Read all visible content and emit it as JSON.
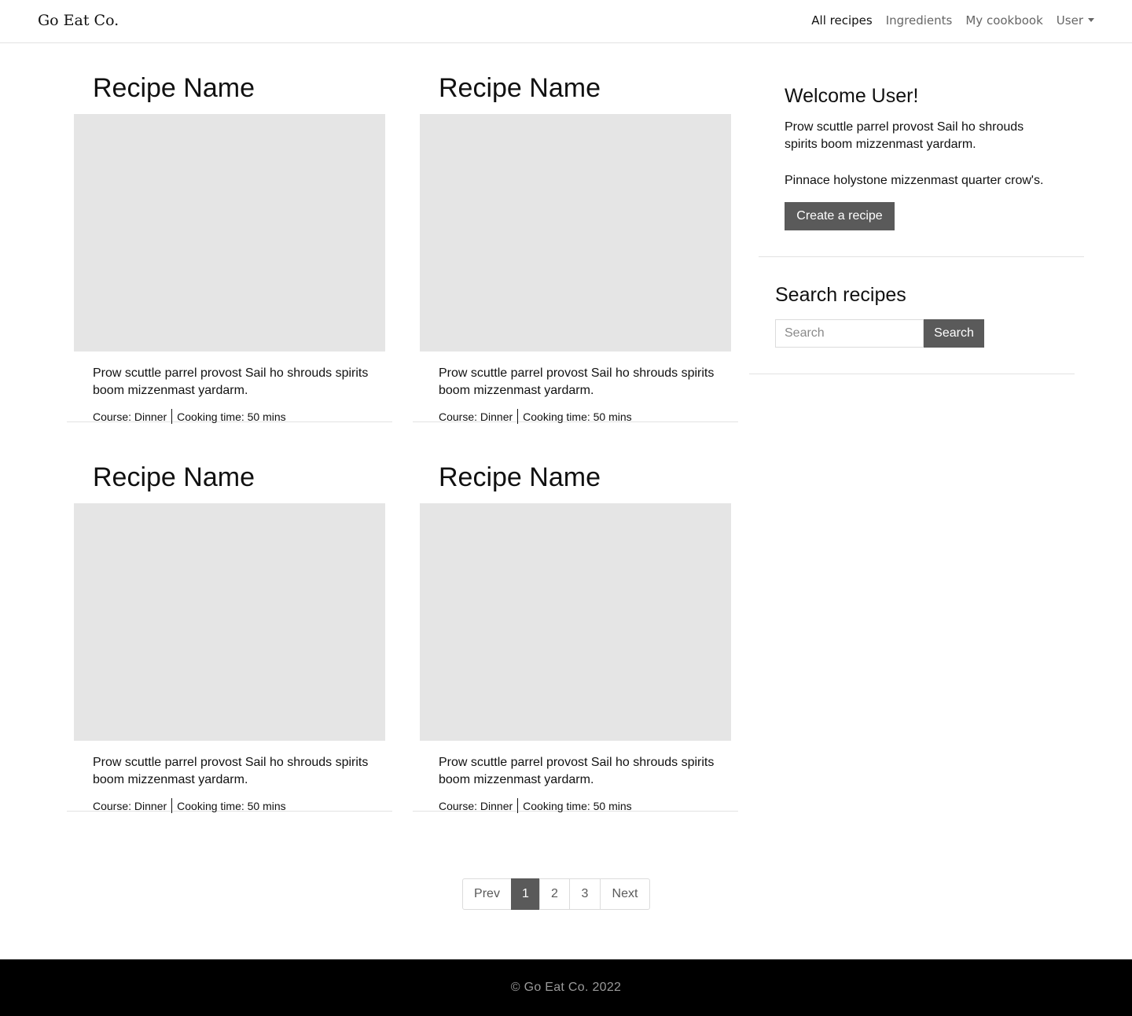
{
  "brand": "Go Eat Co.",
  "nav": {
    "items": [
      {
        "label": "All recipes",
        "active": true
      },
      {
        "label": "Ingredients",
        "active": false
      },
      {
        "label": "My cookbook",
        "active": false
      },
      {
        "label": "User",
        "active": false,
        "dropdown": true
      }
    ]
  },
  "recipes": [
    {
      "name": "Recipe Name",
      "description": "Prow scuttle parrel provost Sail ho shrouds spirits boom mizzenmast yardarm.",
      "course": "Course: Dinner",
      "cooking_time": "Cooking time: 50 mins"
    },
    {
      "name": "Recipe Name",
      "description": "Prow scuttle parrel provost Sail ho shrouds spirits boom mizzenmast yardarm.",
      "course": "Course: Dinner",
      "cooking_time": "Cooking time: 50 mins"
    },
    {
      "name": "Recipe Name",
      "description": "Prow scuttle parrel provost Sail ho shrouds spirits boom mizzenmast yardarm.",
      "course": "Course: Dinner",
      "cooking_time": "Cooking time: 50 mins"
    },
    {
      "name": "Recipe Name",
      "description": "Prow scuttle parrel provost Sail ho shrouds spirits boom mizzenmast yardarm.",
      "course": "Course: Dinner",
      "cooking_time": "Cooking time: 50 mins"
    }
  ],
  "sidebar": {
    "welcome": {
      "title": "Welcome User!",
      "paragraph1": "Prow scuttle parrel provost Sail ho shrouds spirits boom mizzenmast yardarm.",
      "paragraph2": "Pinnace holystone mizzenmast quarter crow's.",
      "button_label": "Create a recipe"
    },
    "search": {
      "title": "Search recipes",
      "placeholder": "Search",
      "value": "",
      "button_label": "Search"
    }
  },
  "pagination": {
    "prev": "Prev",
    "pages": [
      "1",
      "2",
      "3"
    ],
    "current": "1",
    "next": "Next"
  },
  "footer": {
    "text": "© Go Eat Co. 2022"
  },
  "colors": {
    "button_bg": "#5a5a5a",
    "image_placeholder": "#e5e5e5",
    "footer_bg": "#000000"
  }
}
